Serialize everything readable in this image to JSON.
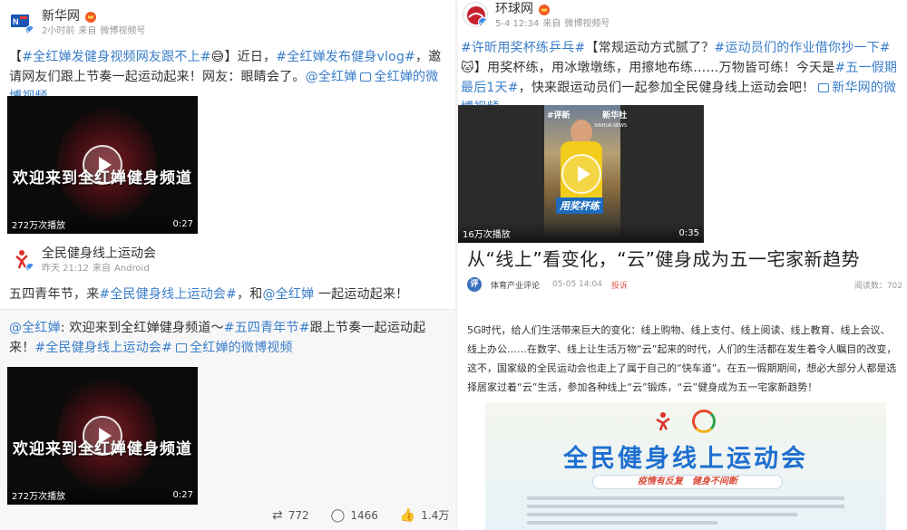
{
  "left": {
    "post1": {
      "author": "新华网",
      "time": "2小时前",
      "source": "来自",
      "source_name": "微博视频号",
      "text": {
        "open": "【",
        "tag1": "#全红婵发健身视频网友跟不上#",
        "emoji": "😅",
        "mid1": "】近日，",
        "tag2": "#全红婵发布健身vlog#",
        "mid2": "，邀请网友们跟上节奏一起运动起来！网友：眼睛会了。",
        "mention": "@全红婵",
        "video_link": "全红婵的微博视频"
      },
      "video": {
        "title": "欢迎来到全红婵健身频道",
        "plays": "272万次播放",
        "duration": "0:27"
      }
    },
    "post2": {
      "author": "全民健身线上运动会",
      "time": "昨天 21:12",
      "source": "来自",
      "source_name": "Android",
      "text": {
        "pre": "五四青年节，来",
        "tag": "#全民健身线上运动会#",
        "mid": "，和",
        "mention": "@全红婵",
        "post": " 一起运动起来！"
      },
      "retweet": {
        "mention": "@全红婵",
        "t1": ": 欢迎来到全红婵健身频道～",
        "tag1": "#五四青年节#",
        "t2": "跟上节奏一起运动起来！",
        "tag2": "#全民健身线上运动会#",
        "video_link": "全红婵的微博视频"
      },
      "video": {
        "title": "欢迎来到全红婵健身频道",
        "plays": "272万次播放",
        "duration": "0:27"
      },
      "actions": {
        "repost": "772",
        "comment": "1466",
        "like": "1.4万"
      }
    }
  },
  "right": {
    "post": {
      "author": "环球网",
      "time": "5-4 12:34",
      "source": "来自",
      "source_name": "微博视频号",
      "text": {
        "tag1": "#许昕用奖杯练乒乓#",
        "t1": "【常规运动方式腻了？",
        "tag2": "#运动员们的作业借你抄一下#",
        "emoji": "🐱",
        "t2": "】用奖杯练，用冰墩墩练，用擦地布练……万物皆可练！今天是",
        "tag3": "#五一假期最后1天#",
        "t3": "，快来跟运动员们一起参加全民健身线上运动会吧！",
        "video_link": "新华网的微博视频"
      },
      "video": {
        "logo_left": "#评新",
        "logo_right": "新华社",
        "logo_right_sub": "XINHUA NEWS",
        "caption": "用奖杯练",
        "plays": "16万次播放",
        "duration": "0:35"
      }
    },
    "article": {
      "title": "从“线上”看变化，“云”健身成为五一宅家新趋势",
      "avatar_char": "评",
      "source": "体育产业评论",
      "date": "05-05 14:04",
      "tip": "投诉",
      "reads": "阅读数：702",
      "body": "5G时代，给人们生活带来巨大的变化：线上购物、线上支付、线上阅读、线上教育、线上会议、线上办公……在数字、线上让生活万物“云”起来的时代，人们的生活都在发生着令人瞩目的改变，这不，国家级的全民运动会也走上了属于自己的“快车道”。在五一假期期间，想必大部分人都是选择居家过着“云”生活，参加各种线上“云”锻炼，“云”健身成为五一宅家新趋势！",
      "poster": {
        "title": "全民健身线上运动会",
        "tagline": "疫情有反复　健身不间断"
      }
    }
  },
  "colors": {
    "link": "#3a7dc9",
    "accent": "#f05a24"
  }
}
